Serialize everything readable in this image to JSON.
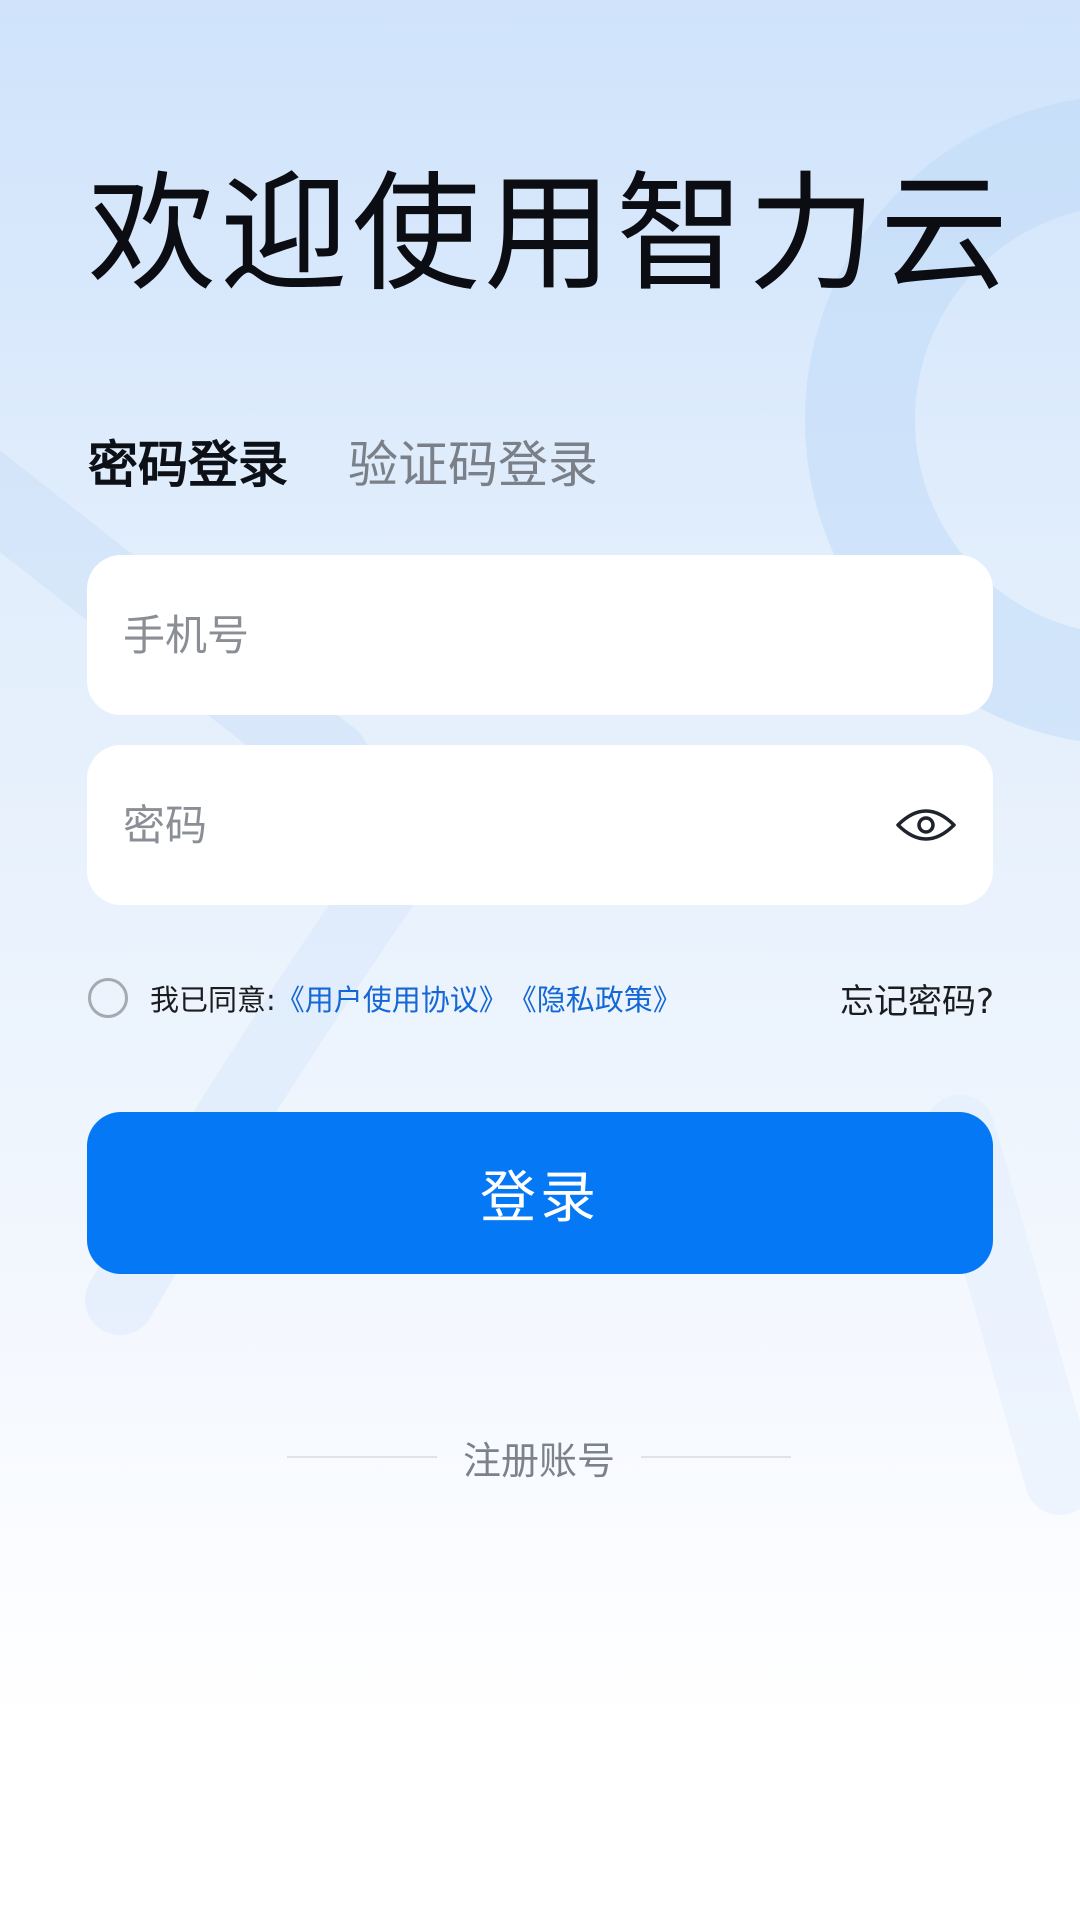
{
  "title": "欢迎使用智力云",
  "tabs": [
    {
      "label": "密码登录",
      "active": true
    },
    {
      "label": "验证码登录",
      "active": false
    }
  ],
  "form": {
    "phone": {
      "placeholder": "手机号",
      "value": ""
    },
    "password": {
      "placeholder": "密码",
      "value": ""
    }
  },
  "agreement": {
    "checked": false,
    "prefix": "我已同意:",
    "user_agreement": "《用户使用协议》",
    "privacy_policy": "《隐私政策》"
  },
  "forgot_password": "忘记密码?",
  "login_button": "登录",
  "register": "注册账号",
  "icons": {
    "password_toggle": "eye-icon",
    "agreement_checkbox": "radio-circle"
  },
  "colors": {
    "primary": "#0478f5",
    "link": "#1467d4",
    "title_text": "#0b0d12",
    "placeholder": "#8a8e95",
    "inactive_tab": "#7b8088",
    "field_background": "#ffffff"
  }
}
